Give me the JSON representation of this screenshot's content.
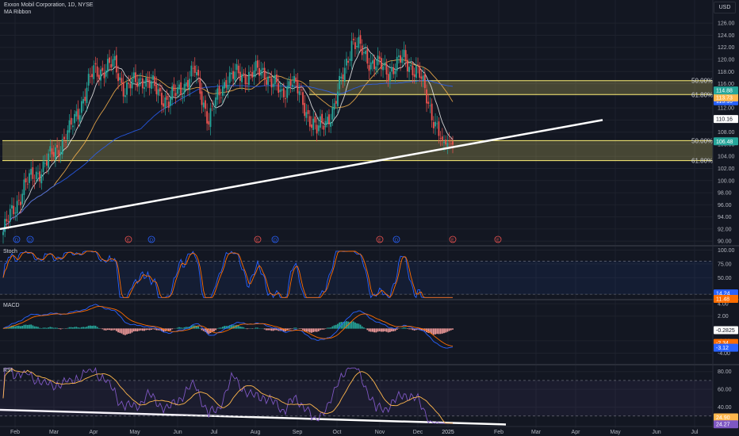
{
  "header": {
    "symbol_line": "Exxon Mobil Corporation, 1D, NYSE",
    "indicator": "MA Ribbon",
    "currency_button": "USD"
  },
  "colors": {
    "background": "#131722",
    "grid": "#1e222d",
    "candle_up": "#26a69a",
    "candle_down": "#ef5350",
    "fib_zone": "#fff176",
    "trendline": "#ffffff",
    "ma_fast": "#f5f5f5",
    "ma_mid": "#ffb74d",
    "ma_slow": "#2962ff",
    "stoch_k": "#2962ff",
    "stoch_d": "#ff6d00",
    "macd_line": "#2962ff",
    "signal_line": "#ff6d00",
    "rsi_line": "#7e57c2"
  },
  "chart_data": [
    {
      "type": "candlestick",
      "panel": "price",
      "title": "Exxon Mobil Corporation, 1D, NYSE",
      "x_axis_labels": [
        "Feb",
        "Mar",
        "Apr",
        "May",
        "Jun",
        "Jul",
        "Aug",
        "Sep",
        "Oct",
        "Nov",
        "Dec",
        "2025",
        "Feb",
        "Mar",
        "Apr",
        "May",
        "Jun",
        "Jul"
      ],
      "y_ticks": [
        90,
        92,
        94,
        96,
        98,
        100,
        102,
        104,
        106,
        108,
        110,
        112,
        114,
        116,
        118,
        120,
        122,
        124,
        126
      ],
      "ylim": [
        89.5,
        127.2
      ],
      "price_labels": [
        {
          "text": "106.48",
          "value": 106.48,
          "color": "#26a69a"
        },
        {
          "text": "110.16",
          "value": 110.16,
          "color": "#ffffff"
        },
        {
          "text": "113.10",
          "value": 113.1,
          "color": "#2962ff"
        },
        {
          "text": "113.73",
          "value": 113.73,
          "color": "#ffb74d"
        },
        {
          "text": "114.88",
          "value": 114.88,
          "color": "#26a69a"
        }
      ],
      "fib_levels": [
        {
          "label": "50.00%",
          "value": 116.5
        },
        {
          "label": "61.80%",
          "value": 114.2
        },
        {
          "label": "50.00%",
          "value": 106.6
        },
        {
          "label": "61.80%",
          "value": 103.3
        }
      ],
      "event_markers": [
        "D",
        "D",
        "E",
        "D",
        "E",
        "D",
        "E",
        "D",
        "E",
        "E"
      ],
      "moving_averages": [
        "fast",
        "mid",
        "slow"
      ],
      "trendline": {
        "from": {
          "date": "2024-01-17",
          "price": 92.0
        },
        "to": {
          "date": "2025-03-28",
          "price": 110.0
        }
      }
    },
    {
      "type": "line",
      "panel": "stoch",
      "title": "Stoch",
      "y_ticks": [
        20,
        50,
        75,
        100
      ],
      "ylim": [
        13,
        105
      ],
      "band": [
        20,
        80
      ],
      "series": [
        {
          "value_label": "14.24",
          "value": 14.24
        },
        {
          "value_label": "11.48",
          "value": 11.48
        }
      ]
    },
    {
      "type": "histogram+line",
      "panel": "macd",
      "title": "MACD",
      "y_ticks": [
        4.0,
        2.0,
        -2.0,
        -4.0
      ],
      "ylim": [
        -5.6,
        4.4
      ],
      "labels": [
        {
          "text": "-0.2825",
          "value": -0.2825
        },
        {
          "text": "-2.34",
          "value": -2.34
        },
        {
          "text": "-3.12",
          "value": -3.12
        }
      ]
    },
    {
      "type": "line",
      "panel": "rsi",
      "title": "RSI",
      "y_ticks": [
        40.0,
        60.0,
        80.0
      ],
      "ylim": [
        20,
        86
      ],
      "band": [
        30,
        70
      ],
      "labels": [
        {
          "text": "24.90",
          "value": 24.9
        },
        {
          "text": "24.27",
          "value": 24.27
        }
      ]
    }
  ]
}
